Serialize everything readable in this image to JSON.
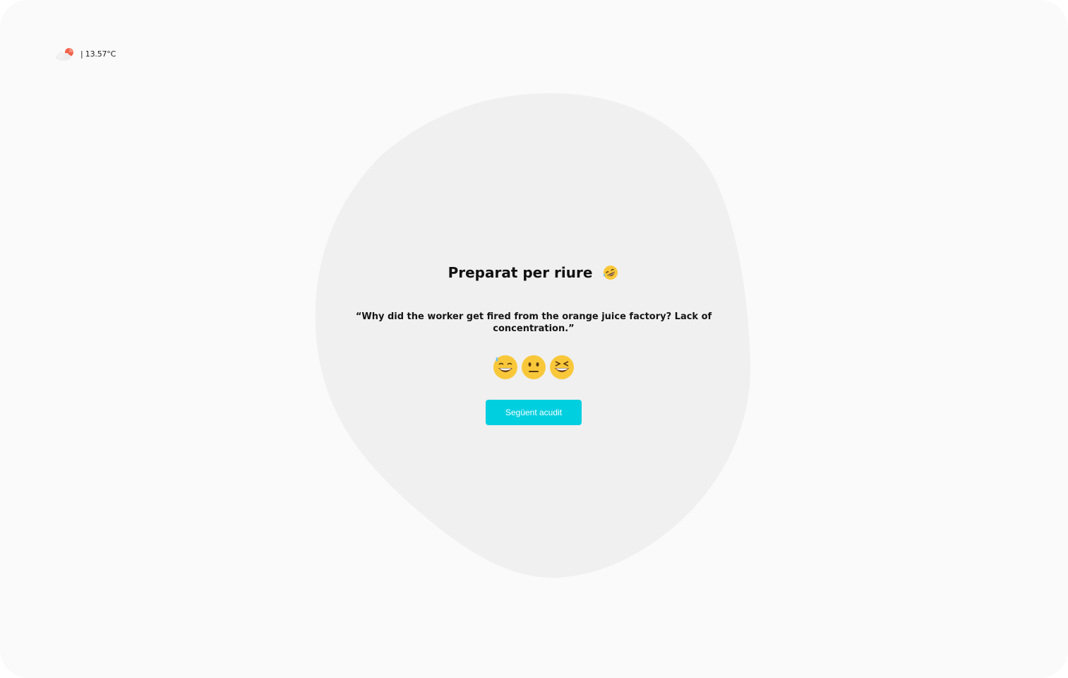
{
  "weather": {
    "icon": "cloud-sun-icon",
    "temperature": "| 13.57°C"
  },
  "card": {
    "title": "Preparat per riure",
    "title_icon": "rolling-on-floor-laughing-emoji",
    "joke": "“Why did the worker get fired from the orange juice factory? Lack of concentration.”"
  },
  "reactions": [
    {
      "icon": "grinning-sweat-emoji"
    },
    {
      "icon": "neutral-face-emoji"
    },
    {
      "icon": "squinting-laughing-emoji"
    }
  ],
  "next_button": {
    "label": "Següent acudit",
    "color": "#00cfe0"
  },
  "colors": {
    "background": "#fafafa",
    "blob": "#f0f0f0"
  }
}
